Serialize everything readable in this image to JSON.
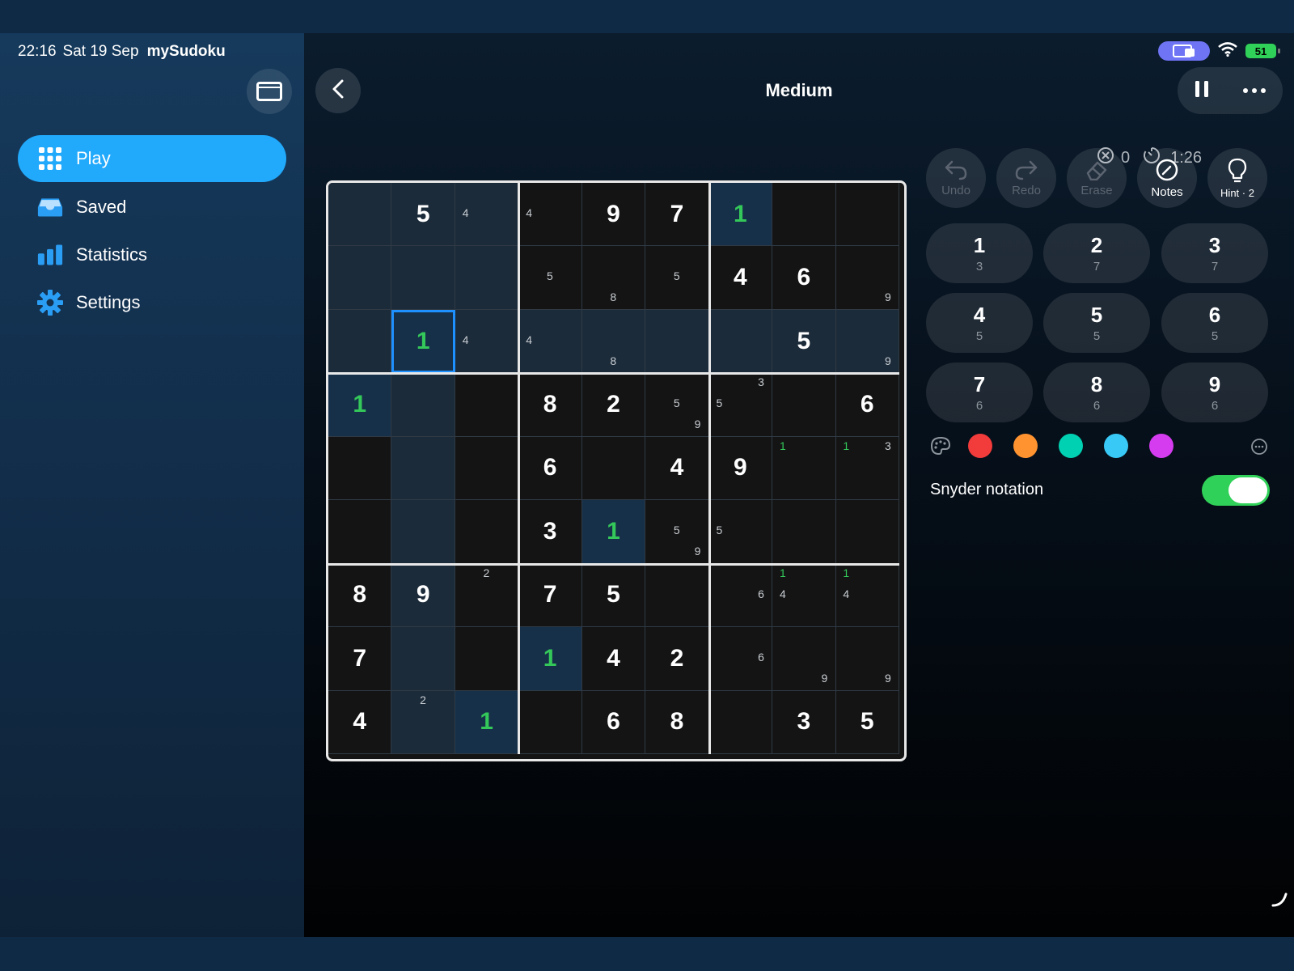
{
  "status_bar": {
    "time": "22:16",
    "date": "Sat 19 Sep",
    "app": "mySudoku",
    "battery": "51"
  },
  "sidebar": {
    "items": [
      {
        "label": "Play",
        "icon": "grid-icon",
        "active": true
      },
      {
        "label": "Saved",
        "icon": "tray-icon",
        "active": false
      },
      {
        "label": "Statistics",
        "icon": "bar-chart-icon",
        "active": false
      },
      {
        "label": "Settings",
        "icon": "gear-icon",
        "active": false
      }
    ]
  },
  "header": {
    "title": "Medium"
  },
  "stats": {
    "mistakes": "0",
    "time": "1:26"
  },
  "tools": [
    {
      "label": "Undo",
      "icon": "undo-icon",
      "enabled": false
    },
    {
      "label": "Redo",
      "icon": "redo-icon",
      "enabled": false
    },
    {
      "label": "Erase",
      "icon": "eraser-icon",
      "enabled": false
    },
    {
      "label": "Notes",
      "icon": "pencil-icon",
      "enabled": true
    },
    {
      "label": "Hint · 2",
      "icon": "lightbulb-icon",
      "enabled": true
    }
  ],
  "numpad": [
    {
      "digit": "1",
      "count": "3"
    },
    {
      "digit": "2",
      "count": "7"
    },
    {
      "digit": "3",
      "count": "7"
    },
    {
      "digit": "4",
      "count": "5"
    },
    {
      "digit": "5",
      "count": "5"
    },
    {
      "digit": "6",
      "count": "5"
    },
    {
      "digit": "7",
      "count": "6"
    },
    {
      "digit": "8",
      "count": "6"
    },
    {
      "digit": "9",
      "count": "6"
    }
  ],
  "colors": [
    "#f23b3b",
    "#ff9330",
    "#00d1b2",
    "#38c9f7",
    "#d53cf0"
  ],
  "snyder": {
    "label": "Snyder notation",
    "enabled": true
  },
  "board": {
    "selected": [
      2,
      1
    ],
    "highlight_color": "#1c2b3a",
    "focus_color": "#163049",
    "cells": [
      [
        "",
        "5",
        "",
        "",
        "9",
        "7",
        "g1",
        "",
        ""
      ],
      [
        "",
        "",
        "",
        "",
        "",
        "",
        "4",
        "6",
        ""
      ],
      [
        "",
        "g1",
        "",
        "",
        "",
        "",
        "",
        "5",
        ""
      ],
      [
        "g1",
        "",
        "",
        "8",
        "2",
        "",
        "",
        "",
        "6"
      ],
      [
        "",
        "",
        "",
        "6",
        "",
        "4",
        "9",
        "",
        ""
      ],
      [
        "",
        "",
        "",
        "3",
        "g1",
        "",
        "",
        "",
        ""
      ],
      [
        "8",
        "9",
        "",
        "7",
        "5",
        "",
        "",
        "",
        ""
      ],
      [
        "7",
        "",
        "",
        "g1",
        "4",
        "2",
        "",
        "",
        ""
      ],
      [
        "4",
        "",
        "g1",
        "",
        "6",
        "8",
        "",
        "3",
        "5"
      ]
    ],
    "notes": [
      {
        "r": 0,
        "c": 2,
        "items": [
          {
            "d": "4",
            "p": "ml"
          }
        ]
      },
      {
        "r": 0,
        "c": 3,
        "items": [
          {
            "d": "4",
            "p": "ml"
          }
        ]
      },
      {
        "r": 1,
        "c": 3,
        "items": [
          {
            "d": "5",
            "p": "mc"
          }
        ]
      },
      {
        "r": 1,
        "c": 4,
        "items": [
          {
            "d": "8",
            "p": "bc"
          }
        ]
      },
      {
        "r": 1,
        "c": 5,
        "items": [
          {
            "d": "5",
            "p": "mc"
          }
        ]
      },
      {
        "r": 1,
        "c": 8,
        "items": [
          {
            "d": "9",
            "p": "br"
          }
        ]
      },
      {
        "r": 2,
        "c": 2,
        "items": [
          {
            "d": "4",
            "p": "ml"
          }
        ]
      },
      {
        "r": 2,
        "c": 3,
        "items": [
          {
            "d": "4",
            "p": "ml"
          }
        ]
      },
      {
        "r": 2,
        "c": 4,
        "items": [
          {
            "d": "8",
            "p": "bc"
          }
        ]
      },
      {
        "r": 2,
        "c": 8,
        "items": [
          {
            "d": "9",
            "p": "br"
          }
        ]
      },
      {
        "r": 3,
        "c": 5,
        "items": [
          {
            "d": "5",
            "p": "mc"
          },
          {
            "d": "9",
            "p": "br"
          }
        ]
      },
      {
        "r": 3,
        "c": 6,
        "items": [
          {
            "d": "3",
            "p": "tr"
          },
          {
            "d": "5",
            "p": "ml"
          }
        ]
      },
      {
        "r": 4,
        "c": 7,
        "items": [
          {
            "d": "1",
            "p": "tl",
            "g": true
          }
        ]
      },
      {
        "r": 4,
        "c": 8,
        "items": [
          {
            "d": "1",
            "p": "tl",
            "g": true
          },
          {
            "d": "3",
            "p": "tr"
          }
        ]
      },
      {
        "r": 5,
        "c": 5,
        "items": [
          {
            "d": "5",
            "p": "mc"
          },
          {
            "d": "9",
            "p": "br"
          }
        ]
      },
      {
        "r": 5,
        "c": 6,
        "items": [
          {
            "d": "5",
            "p": "ml"
          }
        ]
      },
      {
        "r": 6,
        "c": 2,
        "items": [
          {
            "d": "2",
            "p": "tc"
          }
        ]
      },
      {
        "r": 6,
        "c": 6,
        "items": [
          {
            "d": "6",
            "p": "mr"
          }
        ]
      },
      {
        "r": 6,
        "c": 7,
        "items": [
          {
            "d": "1",
            "p": "tl",
            "g": true
          },
          {
            "d": "4",
            "p": "ml"
          }
        ]
      },
      {
        "r": 6,
        "c": 8,
        "items": [
          {
            "d": "1",
            "p": "tl",
            "g": true
          },
          {
            "d": "4",
            "p": "ml"
          }
        ]
      },
      {
        "r": 7,
        "c": 6,
        "items": [
          {
            "d": "6",
            "p": "mr"
          }
        ]
      },
      {
        "r": 7,
        "c": 7,
        "items": [
          {
            "d": "9",
            "p": "br"
          }
        ]
      },
      {
        "r": 7,
        "c": 8,
        "items": [
          {
            "d": "9",
            "p": "br"
          }
        ]
      },
      {
        "r": 8,
        "c": 1,
        "items": [
          {
            "d": "2",
            "p": "tc"
          }
        ]
      }
    ]
  }
}
